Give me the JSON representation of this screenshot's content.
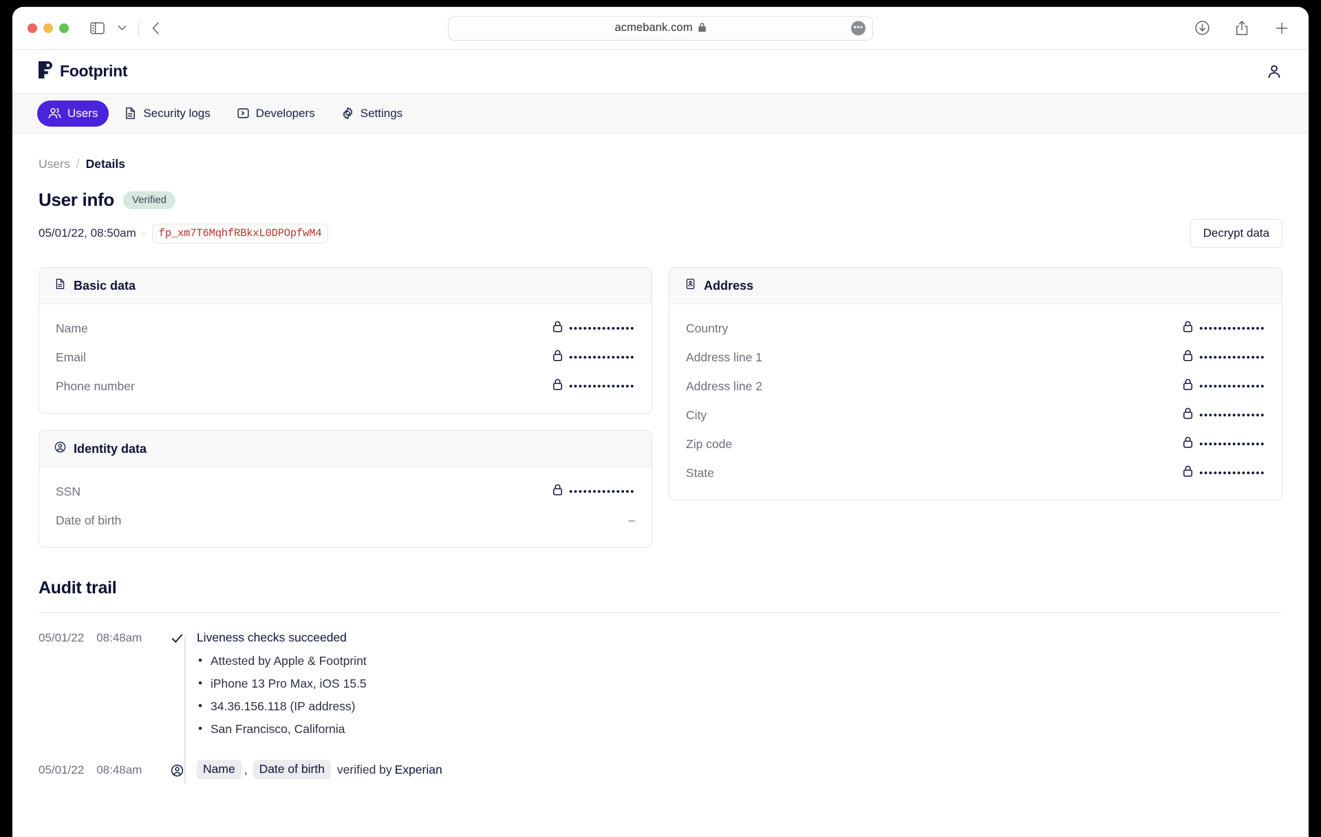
{
  "browser": {
    "url": "acmebank.com",
    "lock_icon": "lock-icon",
    "sidebar_icon": "sidebar-toggle-icon",
    "chevron_icon": "chevron-down-icon",
    "back_icon": "back-arrow-icon",
    "more_icon": "more-options-icon",
    "download_icon": "download-icon",
    "share_icon": "share-icon",
    "newtab_icon": "plus-icon"
  },
  "app": {
    "brand": "Footprint",
    "brand_icon": "footprint-logo-icon",
    "account_icon": "user-account-icon"
  },
  "nav": {
    "tabs": [
      {
        "label": "Users",
        "icon": "users-icon",
        "active": true
      },
      {
        "label": "Security logs",
        "icon": "document-icon",
        "active": false
      },
      {
        "label": "Developers",
        "icon": "code-terminal-icon",
        "active": false
      },
      {
        "label": "Settings",
        "icon": "gear-icon",
        "active": false
      }
    ]
  },
  "breadcrumb": {
    "parent": "Users",
    "separator": "/",
    "current": "Details"
  },
  "user_info": {
    "title": "User info",
    "status_badge": "Verified",
    "timestamp": "05/01/22, 08:50am",
    "separator": "·",
    "token": "fp_xm7T6MqhfRBkxL0DPOpfwM4",
    "decrypt_label": "Decrypt data"
  },
  "cards": {
    "basic_data": {
      "title": "Basic data",
      "icon": "document-icon",
      "rows": [
        {
          "label": "Name",
          "masked": true,
          "value": "••••••••••••••"
        },
        {
          "label": "Email",
          "masked": true,
          "value": "••••••••••••••"
        },
        {
          "label": "Phone number",
          "masked": true,
          "value": "••••••••••••••"
        }
      ]
    },
    "identity_data": {
      "title": "Identity data",
      "icon": "user-circle-icon",
      "rows": [
        {
          "label": "SSN",
          "masked": true,
          "value": "••••••••••••••"
        },
        {
          "label": "Date of birth",
          "masked": false,
          "value": "–"
        }
      ]
    },
    "address": {
      "title": "Address",
      "icon": "building-icon",
      "rows": [
        {
          "label": "Country",
          "masked": true,
          "value": "••••••••••••••"
        },
        {
          "label": "Address line 1",
          "masked": true,
          "value": "••••••••••••••"
        },
        {
          "label": "Address line 2",
          "masked": true,
          "value": "••••••••••••••"
        },
        {
          "label": "City",
          "masked": true,
          "value": "••••••••••••••"
        },
        {
          "label": "Zip code",
          "masked": true,
          "value": "••••••••••••••"
        },
        {
          "label": "State",
          "masked": true,
          "value": "••••••••••••••"
        }
      ]
    }
  },
  "audit": {
    "title": "Audit trail",
    "entries": [
      {
        "date": "05/01/22",
        "time": "08:48am",
        "icon": "checkmark-icon",
        "headline": "Liveness checks succeeded",
        "bullets": [
          "Attested by Apple & Footprint",
          "iPhone 13 Pro Max, iOS 15.5",
          "34.36.156.118 (IP address)",
          "San Francisco, California"
        ]
      },
      {
        "date": "05/01/22",
        "time": "08:48am",
        "icon": "user-circle-icon",
        "chips": [
          "Name",
          "Date of birth"
        ],
        "chip_separator": ",",
        "verified_text": "verified by",
        "verified_by": "Experian"
      }
    ]
  },
  "colors": {
    "accent": "#4a24db",
    "badge_bg": "#d6e8df",
    "token_text": "#b8382f",
    "ink": "#0e1438"
  }
}
